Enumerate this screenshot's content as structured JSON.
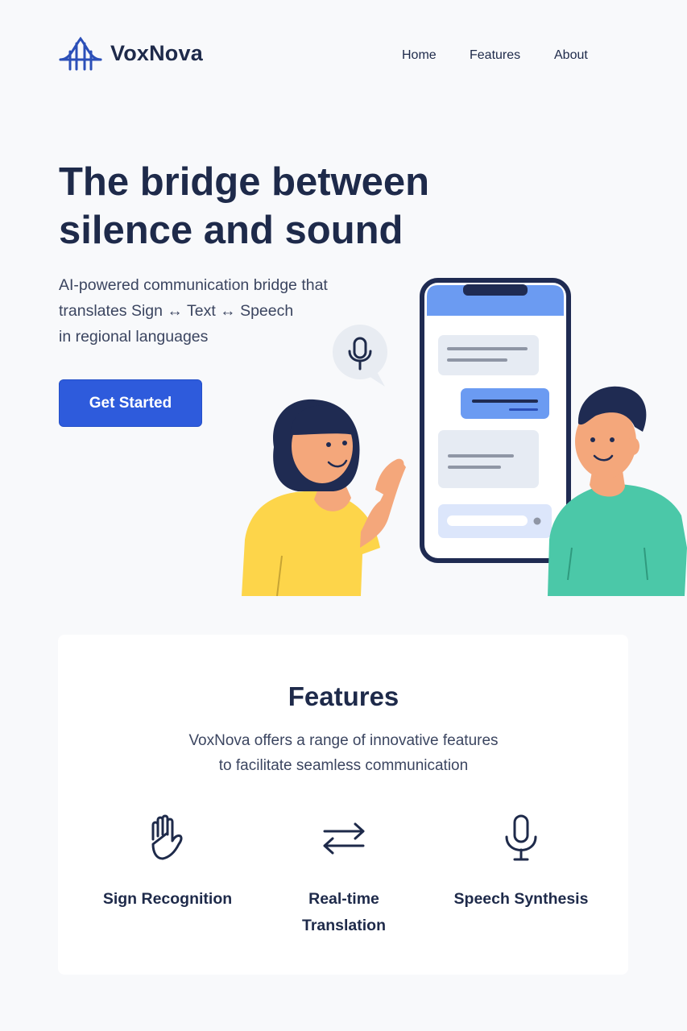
{
  "header": {
    "brand": "VoxNova",
    "logo_icon": "bridge-icon",
    "nav": [
      "Home",
      "Features",
      "About"
    ]
  },
  "hero": {
    "title_line1": "The bridge between",
    "title_line2": "silence and sound",
    "subtitle_line1": "AI-powered communication bridge that",
    "subtitle_line2": "translates Sign ↔ Text ↔ Speech",
    "subtitle_line3": "in regional languages",
    "cta_label": "Get Started",
    "illustration_icon": "microphone-icon"
  },
  "features": {
    "title": "Features",
    "desc_line1": "VoxNova offers a range of innovative features",
    "desc_line2": "to facilitate seamless communication",
    "items": [
      {
        "label": "Sign Recognition",
        "icon": "hand-icon"
      },
      {
        "label": "Real-time Translation",
        "icon": "swap-arrows-icon"
      },
      {
        "label": "Speech Synthesis",
        "icon": "microphone-icon"
      }
    ]
  },
  "colors": {
    "primary": "#2e5bdc",
    "navy": "#1e2a4a",
    "background": "#f8f9fb"
  }
}
